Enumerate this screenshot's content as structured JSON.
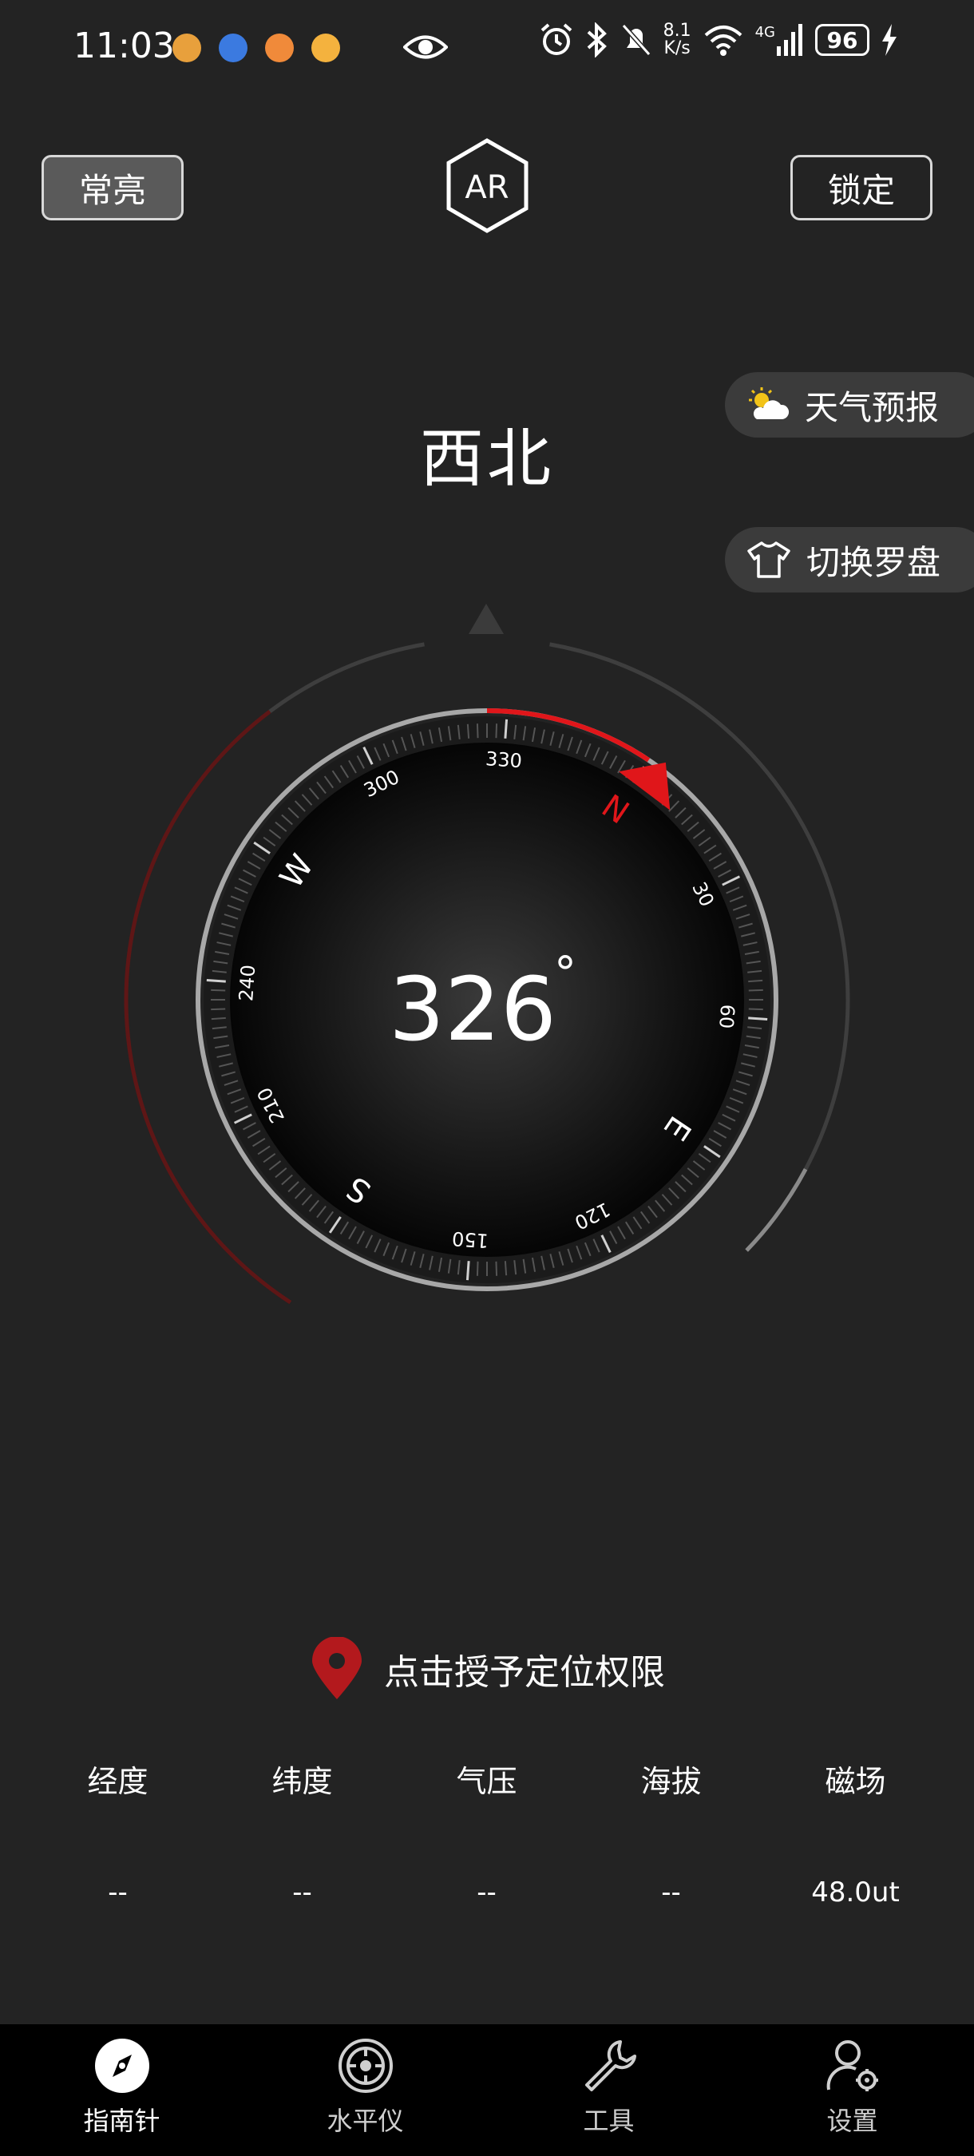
{
  "status_bar": {
    "time": "11:03",
    "net_speed_value": "8.1",
    "net_speed_unit": "K/s",
    "network": "4G",
    "battery": "96"
  },
  "header": {
    "always_on_label": "常亮",
    "logo_text": "AR",
    "lock_label": "锁定"
  },
  "side_buttons": {
    "weather_label": "天气预报",
    "switch_compass_label": "切换罗盘"
  },
  "compass": {
    "direction_name": "西北",
    "heading_value": "326",
    "heading_unit": "°",
    "heading_degrees": 326,
    "cardinals": [
      "N",
      "E",
      "S",
      "W"
    ],
    "degree_labels": [
      "30",
      "60",
      "120",
      "150",
      "210",
      "240",
      "300",
      "330"
    ],
    "accent_color": "#e0161a"
  },
  "location": {
    "permission_text": "点击授予定位权限"
  },
  "info": {
    "labels": [
      "经度",
      "纬度",
      "气压",
      "海拔",
      "磁场"
    ],
    "values": [
      "--",
      "--",
      "--",
      "--",
      "48.0ut"
    ]
  },
  "bottom_nav": {
    "items": [
      {
        "label": "指南针",
        "icon": "compass-icon"
      },
      {
        "label": "水平仪",
        "icon": "level-icon"
      },
      {
        "label": "工具",
        "icon": "wrench-icon"
      },
      {
        "label": "设置",
        "icon": "settings-icon"
      }
    ]
  }
}
